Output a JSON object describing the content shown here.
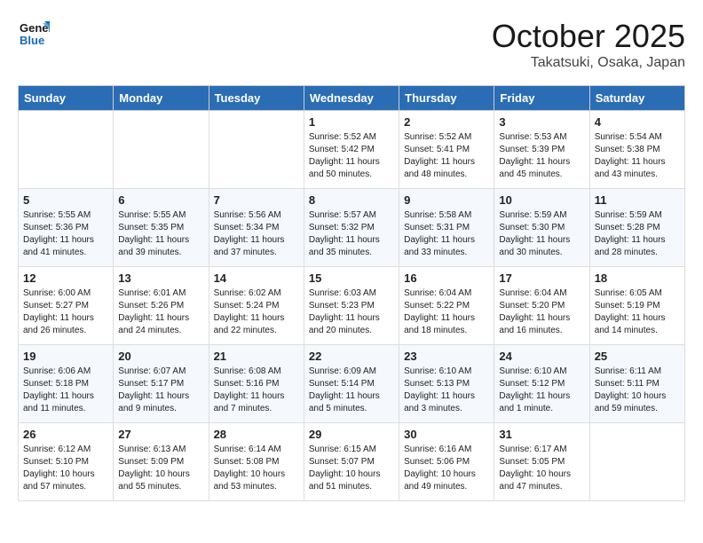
{
  "logo": {
    "line1": "General",
    "line2": "Blue"
  },
  "title": "October 2025",
  "location": "Takatsuki, Osaka, Japan",
  "weekdays": [
    "Sunday",
    "Monday",
    "Tuesday",
    "Wednesday",
    "Thursday",
    "Friday",
    "Saturday"
  ],
  "weeks": [
    [
      {
        "day": "",
        "info": ""
      },
      {
        "day": "",
        "info": ""
      },
      {
        "day": "",
        "info": ""
      },
      {
        "day": "1",
        "info": "Sunrise: 5:52 AM\nSunset: 5:42 PM\nDaylight: 11 hours\nand 50 minutes."
      },
      {
        "day": "2",
        "info": "Sunrise: 5:52 AM\nSunset: 5:41 PM\nDaylight: 11 hours\nand 48 minutes."
      },
      {
        "day": "3",
        "info": "Sunrise: 5:53 AM\nSunset: 5:39 PM\nDaylight: 11 hours\nand 45 minutes."
      },
      {
        "day": "4",
        "info": "Sunrise: 5:54 AM\nSunset: 5:38 PM\nDaylight: 11 hours\nand 43 minutes."
      }
    ],
    [
      {
        "day": "5",
        "info": "Sunrise: 5:55 AM\nSunset: 5:36 PM\nDaylight: 11 hours\nand 41 minutes."
      },
      {
        "day": "6",
        "info": "Sunrise: 5:55 AM\nSunset: 5:35 PM\nDaylight: 11 hours\nand 39 minutes."
      },
      {
        "day": "7",
        "info": "Sunrise: 5:56 AM\nSunset: 5:34 PM\nDaylight: 11 hours\nand 37 minutes."
      },
      {
        "day": "8",
        "info": "Sunrise: 5:57 AM\nSunset: 5:32 PM\nDaylight: 11 hours\nand 35 minutes."
      },
      {
        "day": "9",
        "info": "Sunrise: 5:58 AM\nSunset: 5:31 PM\nDaylight: 11 hours\nand 33 minutes."
      },
      {
        "day": "10",
        "info": "Sunrise: 5:59 AM\nSunset: 5:30 PM\nDaylight: 11 hours\nand 30 minutes."
      },
      {
        "day": "11",
        "info": "Sunrise: 5:59 AM\nSunset: 5:28 PM\nDaylight: 11 hours\nand 28 minutes."
      }
    ],
    [
      {
        "day": "12",
        "info": "Sunrise: 6:00 AM\nSunset: 5:27 PM\nDaylight: 11 hours\nand 26 minutes."
      },
      {
        "day": "13",
        "info": "Sunrise: 6:01 AM\nSunset: 5:26 PM\nDaylight: 11 hours\nand 24 minutes."
      },
      {
        "day": "14",
        "info": "Sunrise: 6:02 AM\nSunset: 5:24 PM\nDaylight: 11 hours\nand 22 minutes."
      },
      {
        "day": "15",
        "info": "Sunrise: 6:03 AM\nSunset: 5:23 PM\nDaylight: 11 hours\nand 20 minutes."
      },
      {
        "day": "16",
        "info": "Sunrise: 6:04 AM\nSunset: 5:22 PM\nDaylight: 11 hours\nand 18 minutes."
      },
      {
        "day": "17",
        "info": "Sunrise: 6:04 AM\nSunset: 5:20 PM\nDaylight: 11 hours\nand 16 minutes."
      },
      {
        "day": "18",
        "info": "Sunrise: 6:05 AM\nSunset: 5:19 PM\nDaylight: 11 hours\nand 14 minutes."
      }
    ],
    [
      {
        "day": "19",
        "info": "Sunrise: 6:06 AM\nSunset: 5:18 PM\nDaylight: 11 hours\nand 11 minutes."
      },
      {
        "day": "20",
        "info": "Sunrise: 6:07 AM\nSunset: 5:17 PM\nDaylight: 11 hours\nand 9 minutes."
      },
      {
        "day": "21",
        "info": "Sunrise: 6:08 AM\nSunset: 5:16 PM\nDaylight: 11 hours\nand 7 minutes."
      },
      {
        "day": "22",
        "info": "Sunrise: 6:09 AM\nSunset: 5:14 PM\nDaylight: 11 hours\nand 5 minutes."
      },
      {
        "day": "23",
        "info": "Sunrise: 6:10 AM\nSunset: 5:13 PM\nDaylight: 11 hours\nand 3 minutes."
      },
      {
        "day": "24",
        "info": "Sunrise: 6:10 AM\nSunset: 5:12 PM\nDaylight: 11 hours\nand 1 minute."
      },
      {
        "day": "25",
        "info": "Sunrise: 6:11 AM\nSunset: 5:11 PM\nDaylight: 10 hours\nand 59 minutes."
      }
    ],
    [
      {
        "day": "26",
        "info": "Sunrise: 6:12 AM\nSunset: 5:10 PM\nDaylight: 10 hours\nand 57 minutes."
      },
      {
        "day": "27",
        "info": "Sunrise: 6:13 AM\nSunset: 5:09 PM\nDaylight: 10 hours\nand 55 minutes."
      },
      {
        "day": "28",
        "info": "Sunrise: 6:14 AM\nSunset: 5:08 PM\nDaylight: 10 hours\nand 53 minutes."
      },
      {
        "day": "29",
        "info": "Sunrise: 6:15 AM\nSunset: 5:07 PM\nDaylight: 10 hours\nand 51 minutes."
      },
      {
        "day": "30",
        "info": "Sunrise: 6:16 AM\nSunset: 5:06 PM\nDaylight: 10 hours\nand 49 minutes."
      },
      {
        "day": "31",
        "info": "Sunrise: 6:17 AM\nSunset: 5:05 PM\nDaylight: 10 hours\nand 47 minutes."
      },
      {
        "day": "",
        "info": ""
      }
    ]
  ]
}
